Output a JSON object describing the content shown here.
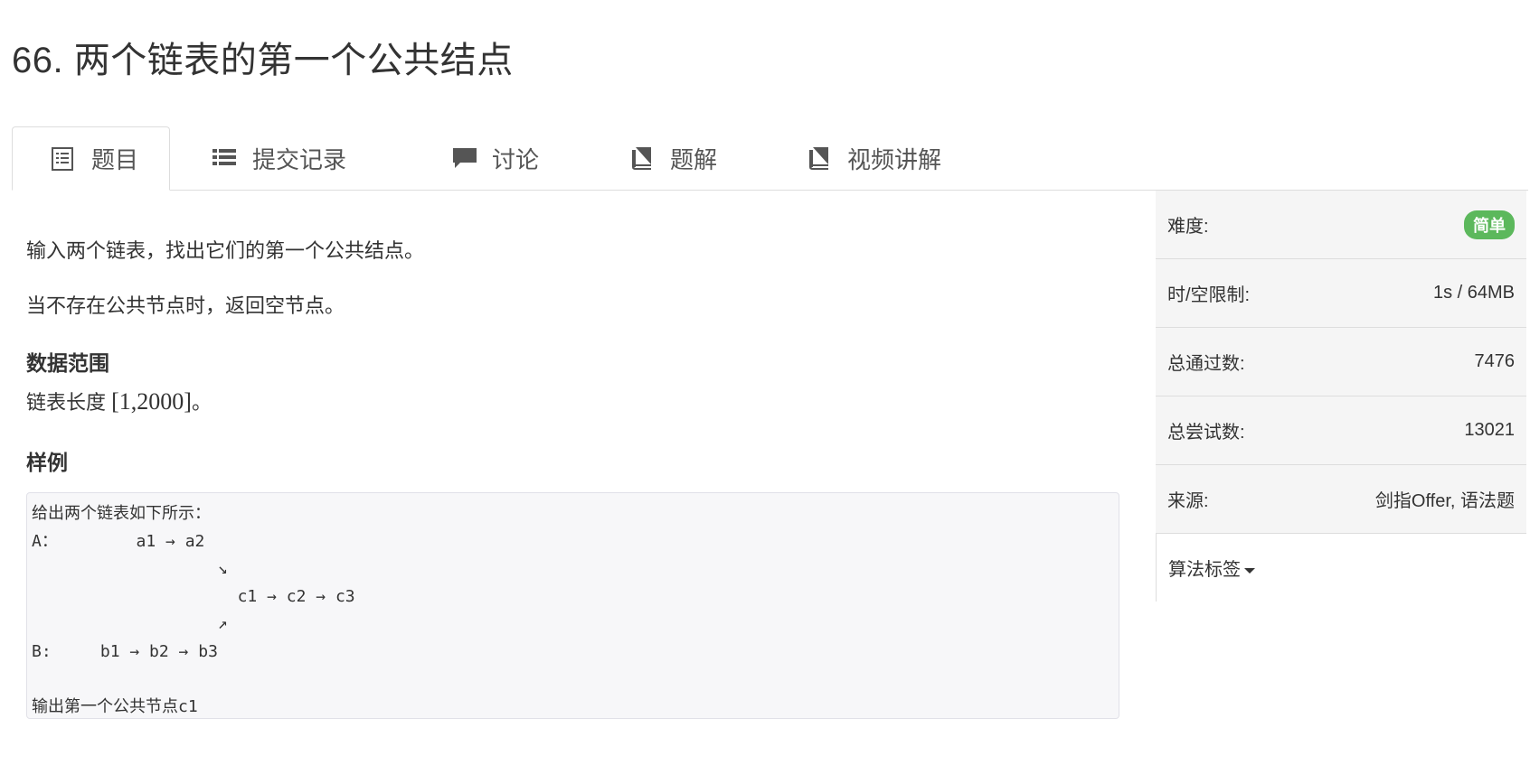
{
  "problem": {
    "title": "66. 两个链表的第一个公共结点"
  },
  "tabs": [
    {
      "label": "题目",
      "icon": "document-icon",
      "active": true
    },
    {
      "label": "提交记录",
      "icon": "list-icon",
      "active": false
    },
    {
      "label": "讨论",
      "icon": "comment-icon",
      "active": false
    },
    {
      "label": "题解",
      "icon": "book-icon",
      "active": false
    },
    {
      "label": "视频讲解",
      "icon": "book-icon",
      "active": false
    }
  ],
  "description": {
    "line1": "输入两个链表，找出它们的第一个公共结点。",
    "line2": "当不存在公共节点时，返回空节点。",
    "range_heading": "数据范围",
    "range_prefix": "链表长度 ",
    "range_math": "[1,2000]",
    "range_suffix": "。",
    "sample_heading": "样例",
    "sample_text": "给出两个链表如下所示：\nA：        a1 → a2\n                   ↘\n                     c1 → c2 → c3\n                   ↗\nB:     b1 → b2 → b3\n\n输出第一个公共节点c1"
  },
  "sidebar": {
    "difficulty_label": "难度:",
    "difficulty_value": "简单",
    "limit_label": "时/空限制:",
    "limit_value": "1s / 64MB",
    "passed_label": "总通过数:",
    "passed_value": "7476",
    "attempts_label": "总尝试数:",
    "attempts_value": "13021",
    "source_label": "来源:",
    "source_value": "剑指Offer, 语法题",
    "tags_label": "算法标签"
  },
  "colors": {
    "badge_green": "#5cb85c",
    "sidebar_bg": "#f5f5f5",
    "border": "#dddddd"
  }
}
